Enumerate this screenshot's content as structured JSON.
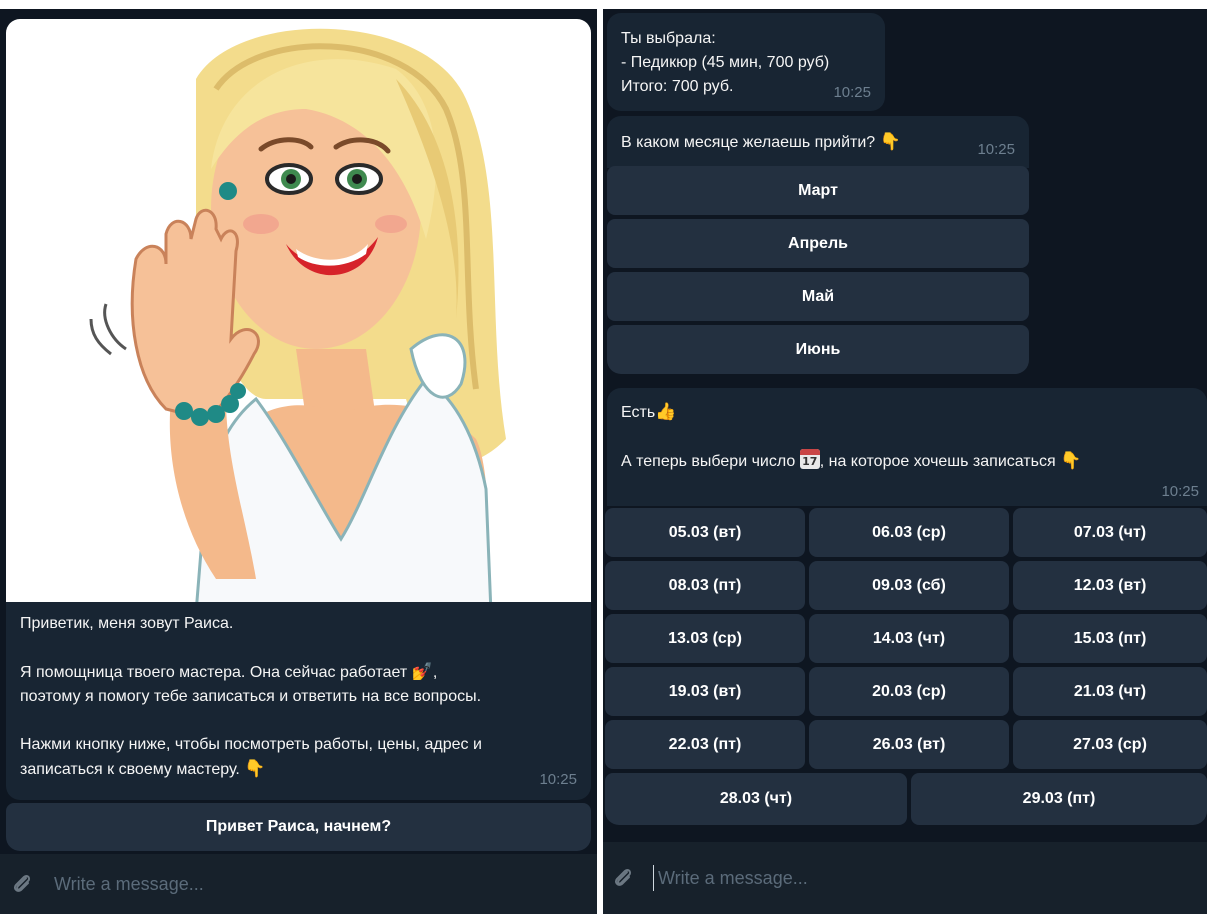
{
  "left": {
    "greeting": {
      "line1": "Приветик, меня зовут Раиса.",
      "line2a": "Я помощница твоего мастера. Она сейчас работает",
      "line2b": "поэтому я помогу тебе записаться и ответить на все вопросы.",
      "line3a": "Нажми кнопку ниже, чтобы посмотреть работы, цены, адрес и",
      "line3b": "записаться к своему мастеру.",
      "time": "10:25"
    },
    "start_button": "Привет Раиса, начнем?",
    "composer_placeholder": "Write a message..."
  },
  "right": {
    "summary": {
      "line1": "Ты выбрала:",
      "line2": "- Педикюр (45 мин, 700 руб)",
      "line3": "Итого: 700 руб.",
      "time": "10:25"
    },
    "month_question": {
      "text": "В каком месяце желаешь прийти?",
      "time": "10:25"
    },
    "months": [
      "Март",
      "Апрель",
      "Май",
      "Июнь"
    ],
    "date_prompt": {
      "line1": "Есть",
      "line2a": "А теперь выбери число",
      "calendar_num": "17",
      "line2b": ", на которое хочешь записаться",
      "time": "10:25"
    },
    "dates": [
      [
        "05.03 (вт)",
        "06.03 (ср)",
        "07.03 (чт)"
      ],
      [
        "08.03 (пт)",
        "09.03 (сб)",
        "12.03 (вт)"
      ],
      [
        "13.03 (ср)",
        "14.03 (чт)",
        "15.03 (пт)"
      ],
      [
        "19.03 (вт)",
        "20.03 (ср)",
        "21.03 (чт)"
      ],
      [
        "22.03 (пт)",
        "26.03 (вт)",
        "27.03 (ср)"
      ],
      [
        "28.03 (чт)",
        "29.03 (пт)"
      ]
    ],
    "composer_placeholder": "Write a message..."
  },
  "colors": {
    "background": "#0e1621",
    "bubble": "#182533",
    "keyboard_button": "#233040",
    "timestamp": "#6d7f8f"
  },
  "icons": {
    "attach": "paperclip-icon",
    "point_down": "point-down-emoji",
    "thumbs_up": "thumbs-up-emoji",
    "nail_polish": "nail-polish-emoji",
    "calendar": "calendar-icon"
  }
}
